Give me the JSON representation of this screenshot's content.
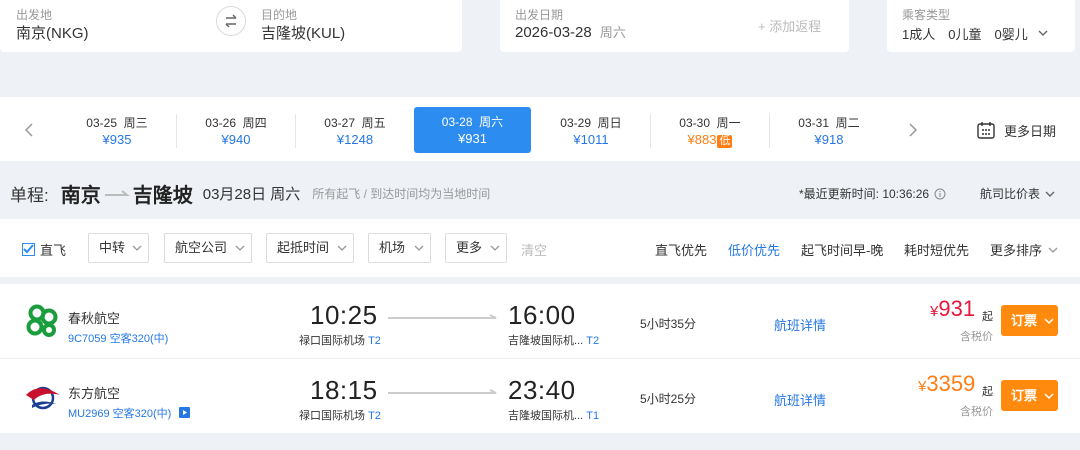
{
  "search": {
    "from_label": "出发地",
    "from_value": "南京(NKG)",
    "to_label": "目的地",
    "to_value": "吉隆坡(KUL)",
    "date_label": "出发日期",
    "date_value": "2026-03-28",
    "date_weekday": "周六",
    "add_return": "+ 添加返程",
    "passenger_label": "乘客类型",
    "passengers": "1成人　0儿童　0婴儿"
  },
  "date_strip": {
    "days": [
      {
        "date": "03-25",
        "weekday": "周三",
        "price": "¥935",
        "selected": false,
        "low": false
      },
      {
        "date": "03-26",
        "weekday": "周四",
        "price": "¥940",
        "selected": false,
        "low": false
      },
      {
        "date": "03-27",
        "weekday": "周五",
        "price": "¥1248",
        "selected": false,
        "low": false
      },
      {
        "date": "03-28",
        "weekday": "周六",
        "price": "¥931",
        "selected": true,
        "low": false
      },
      {
        "date": "03-29",
        "weekday": "周日",
        "price": "¥1011",
        "selected": false,
        "low": false
      },
      {
        "date": "03-30",
        "weekday": "周一",
        "price": "¥883",
        "selected": false,
        "low": true
      },
      {
        "date": "03-31",
        "weekday": "周二",
        "price": "¥918",
        "selected": false,
        "low": false
      }
    ],
    "low_tag": "低",
    "more_dates": "更多日期"
  },
  "route": {
    "prefix": "单程:",
    "from": "南京",
    "to": "吉隆坡",
    "date": "03月28日 周六",
    "note": "所有起飞 / 到达时间均为当地时间",
    "updated": "*最近更新时间: 10:36:26",
    "compare": "航司比价表"
  },
  "filters": {
    "direct": "直飞",
    "items": [
      "中转",
      "航空公司",
      "起抵时间",
      "机场",
      "更多"
    ],
    "clear": "清空",
    "sorts": [
      "直飞优先",
      "低价优先",
      "起飞时间早-晚",
      "耗时短优先",
      "更多排序"
    ]
  },
  "flights": [
    {
      "airline": "春秋航空",
      "flight_no": "9C7059 空客320(中)",
      "dep_time": "10:25",
      "dep_airport": "禄口国际机场",
      "dep_terminal": "T2",
      "arr_time": "16:00",
      "arr_airport": "吉隆坡国际机...",
      "arr_terminal": "T2",
      "duration": "5小时35分",
      "detail": "航班详情",
      "price_symbol": "¥",
      "price": "931",
      "qi": "起",
      "tax": "含税价",
      "book": "订票",
      "price_color": "#e8173c"
    },
    {
      "airline": "东方航空",
      "flight_no": "MU2969 空客320(中)",
      "dep_time": "18:15",
      "dep_airport": "禄口国际机场",
      "dep_terminal": "T2",
      "arr_time": "23:40",
      "arr_airport": "吉隆坡国际机...",
      "arr_terminal": "T1",
      "duration": "5小时25分",
      "detail": "航班详情",
      "price_symbol": "¥",
      "price": "3359",
      "qi": "起",
      "tax": "含税价",
      "book": "订票",
      "price_color": "#ff7d13"
    }
  ],
  "colors": {
    "accent": "#2d8cf0",
    "link": "#2577e3",
    "orange": "#ff8a0d"
  }
}
